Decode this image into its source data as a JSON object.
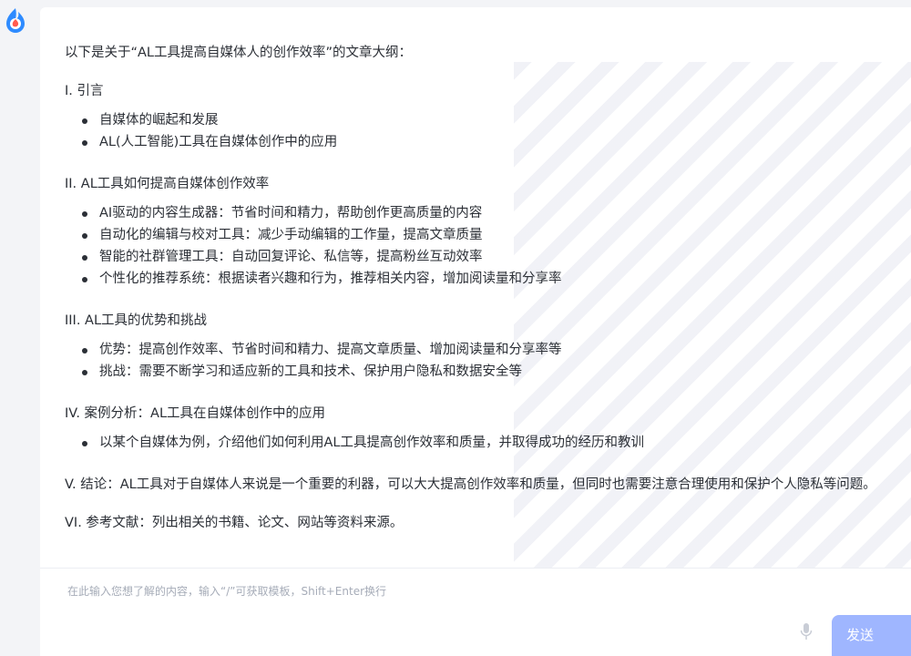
{
  "app": {
    "logo_icon": "app-logo-icon",
    "accent": "#2e8bff"
  },
  "message": {
    "intro": "以下是关于“AL工具提高自媒体人的创作效率”的文章大纲：",
    "sections": [
      {
        "title": "I. 引言",
        "items": [
          "自媒体的崛起和发展",
          "AL(人工智能)工具在自媒体创作中的应用"
        ]
      },
      {
        "title": "II. AL工具如何提高自媒体创作效率",
        "items": [
          "AI驱动的内容生成器：节省时间和精力，帮助创作更高质量的内容",
          "自动化的编辑与校对工具：减少手动编辑的工作量，提高文章质量",
          "智能的社群管理工具：自动回复评论、私信等，提高粉丝互动效率",
          "个性化的推荐系统：根据读者兴趣和行为，推荐相关内容，增加阅读量和分享率"
        ]
      },
      {
        "title": "III. AL工具的优势和挑战",
        "items": [
          "优势：提高创作效率、节省时间和精力、提高文章质量、增加阅读量和分享率等",
          "挑战：需要不断学习和适应新的工具和技术、保护用户隐私和数据安全等"
        ]
      },
      {
        "title": "IV. 案例分析：AL工具在自媒体创作中的应用",
        "items": [
          "以某个自媒体为例，介绍他们如何利用AL工具提高创作效率和质量，并取得成功的经历和教训"
        ]
      }
    ],
    "conclusion": "V. 结论：AL工具对于自媒体人来说是一个重要的利器，可以大大提高创作效率和质量，但同时也需要注意合理使用和保护个人隐私等问题。",
    "references": "VI. 参考文献：列出相关的书籍、论文、网站等资料来源。"
  },
  "input": {
    "placeholder": "在此输入您想了解的内容，输入“/”可获取模板，Shift+Enter换行",
    "mic_icon": "microphone-icon",
    "send_label": "发送"
  }
}
